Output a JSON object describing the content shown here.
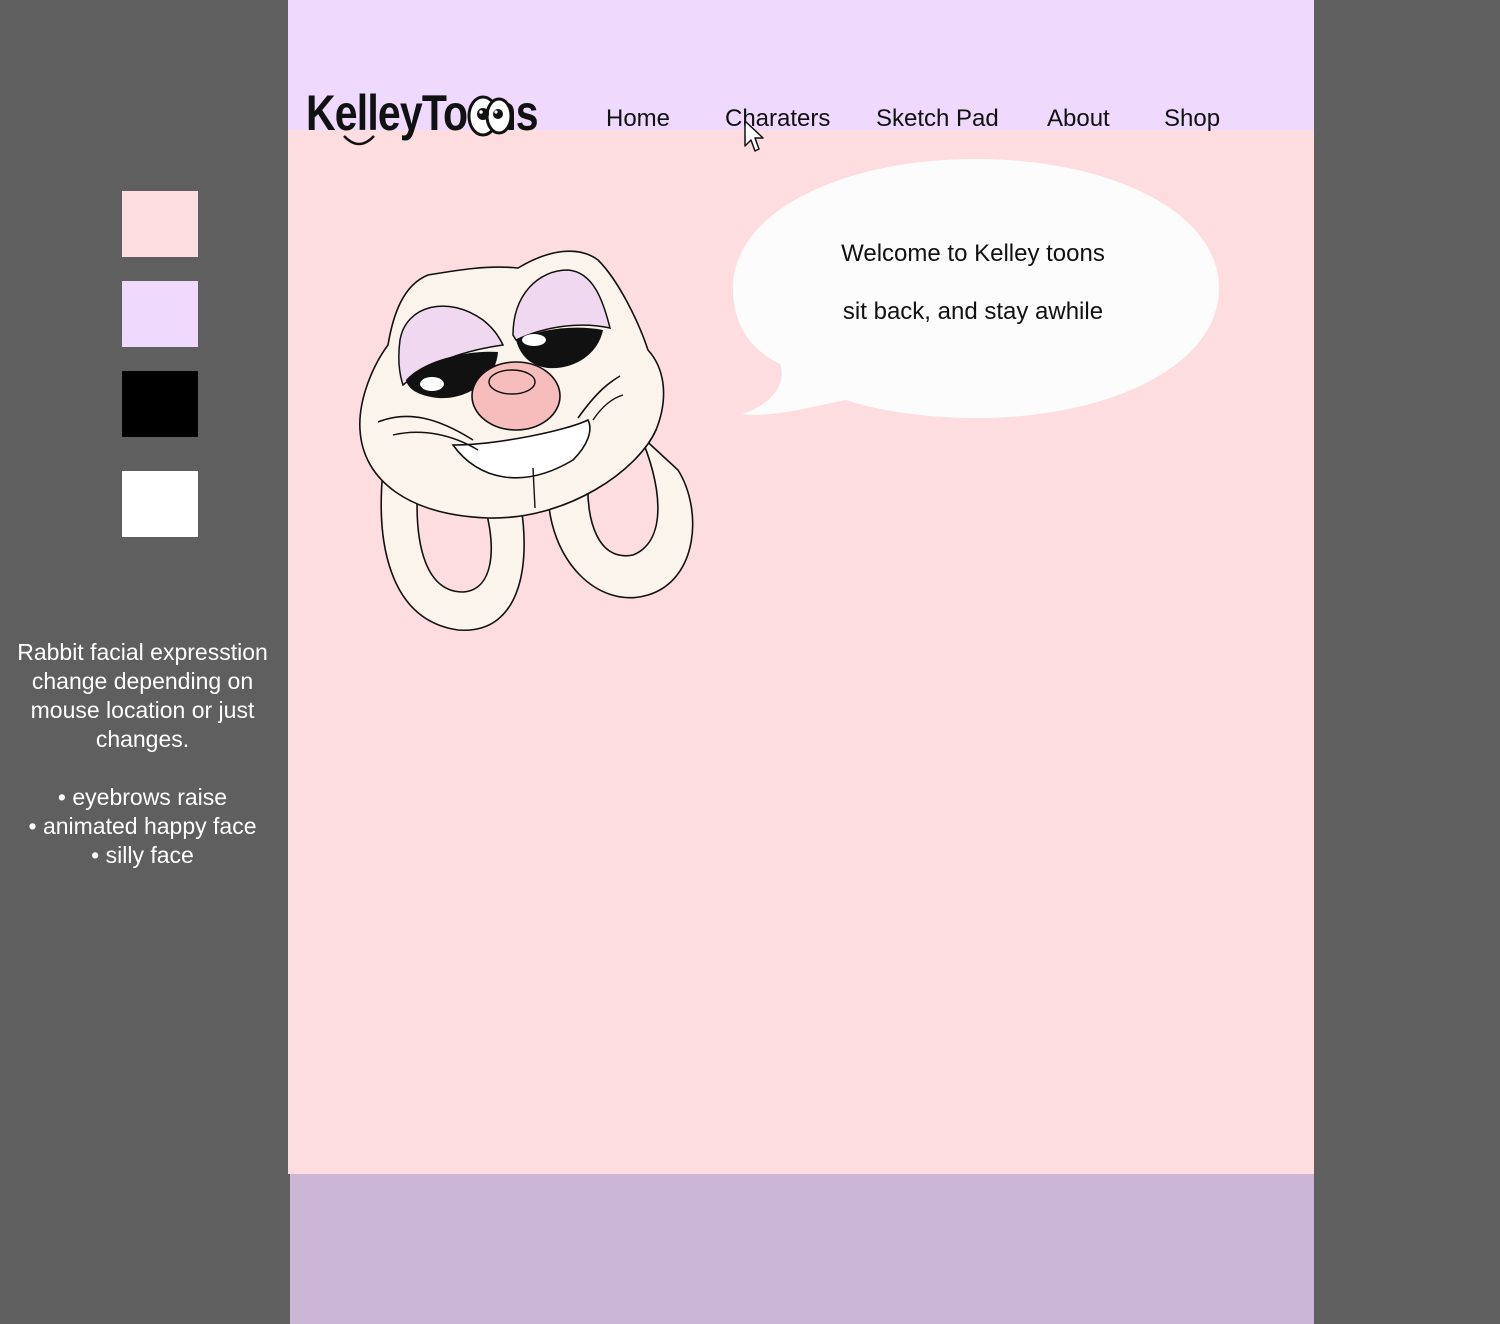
{
  "colors": {
    "background": "#5f5f5f",
    "header": "#efd9fd",
    "content": "#fddde0",
    "footer": "#cbb6d6",
    "bubble": "#fcfcfc",
    "rabbit_fill": "#fbf4ec",
    "rabbit_eyelid": "#f0d8f0",
    "rabbit_nose": "#f7bcbc"
  },
  "palette": [
    {
      "name": "pink",
      "color": "#fddde0"
    },
    {
      "name": "lavender",
      "color": "#efd9fd"
    },
    {
      "name": "black",
      "color": "#000000"
    },
    {
      "name": "white",
      "color": "#ffffff"
    }
  ],
  "notes": {
    "intro": "Rabbit facial expresstion change depending on mouse location or just changes.",
    "bullets": [
      "eyebrows raise",
      "animated happy face",
      "silly face"
    ]
  },
  "logo": {
    "text": "KelleyToons"
  },
  "nav": [
    {
      "label": "Home"
    },
    {
      "label": "Charaters"
    },
    {
      "label": "Sketch Pad"
    },
    {
      "label": "About"
    },
    {
      "label": "Shop"
    }
  ],
  "bubble": {
    "line1": "Welcome to Kelley toons",
    "line2": "sit back, and stay awhile"
  }
}
